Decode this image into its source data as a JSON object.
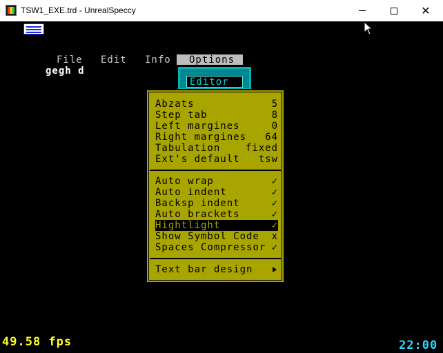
{
  "window": {
    "title": "TSW1_EXE.trd - UnrealSpeccy"
  },
  "menubar": {
    "items": [
      "File",
      "Edit",
      "Info",
      "Options"
    ],
    "active": "Options"
  },
  "document": {
    "text": "gegh d"
  },
  "submenu": {
    "label": "Editor"
  },
  "options_menu": {
    "group1": [
      {
        "label": "Abzats",
        "value": "5"
      },
      {
        "label": "Step tab",
        "value": "8"
      },
      {
        "label": "Left margines",
        "value": "0"
      },
      {
        "label": "Right margines",
        "value": "64"
      },
      {
        "label": "Tabulation",
        "value": "fixed"
      },
      {
        "label": "Ext's default",
        "value": "tsw"
      }
    ],
    "group2": [
      {
        "label": "Auto wrap",
        "value": "✓"
      },
      {
        "label": "Auto indent",
        "value": "✓"
      },
      {
        "label": "Backsp indent",
        "value": "✓"
      },
      {
        "label": "Auto brackets",
        "value": "✓"
      },
      {
        "label": "Hightlight",
        "value": "✓"
      },
      {
        "label": "Show Symbol Code",
        "value": "x"
      },
      {
        "label": "Spaces Compressor",
        "value": "✓"
      }
    ],
    "group3": [
      {
        "label": "Text bar design",
        "icon": "arrow-right-icon"
      }
    ],
    "highlighted": "Hightlight"
  },
  "status": {
    "fps": "49.58 fps",
    "clock": "22:00"
  },
  "colors": {
    "menu_bg": "#a8a400",
    "fps": "#ffff2a",
    "clock": "#2ad4ff",
    "editor": "#00b4b8"
  }
}
